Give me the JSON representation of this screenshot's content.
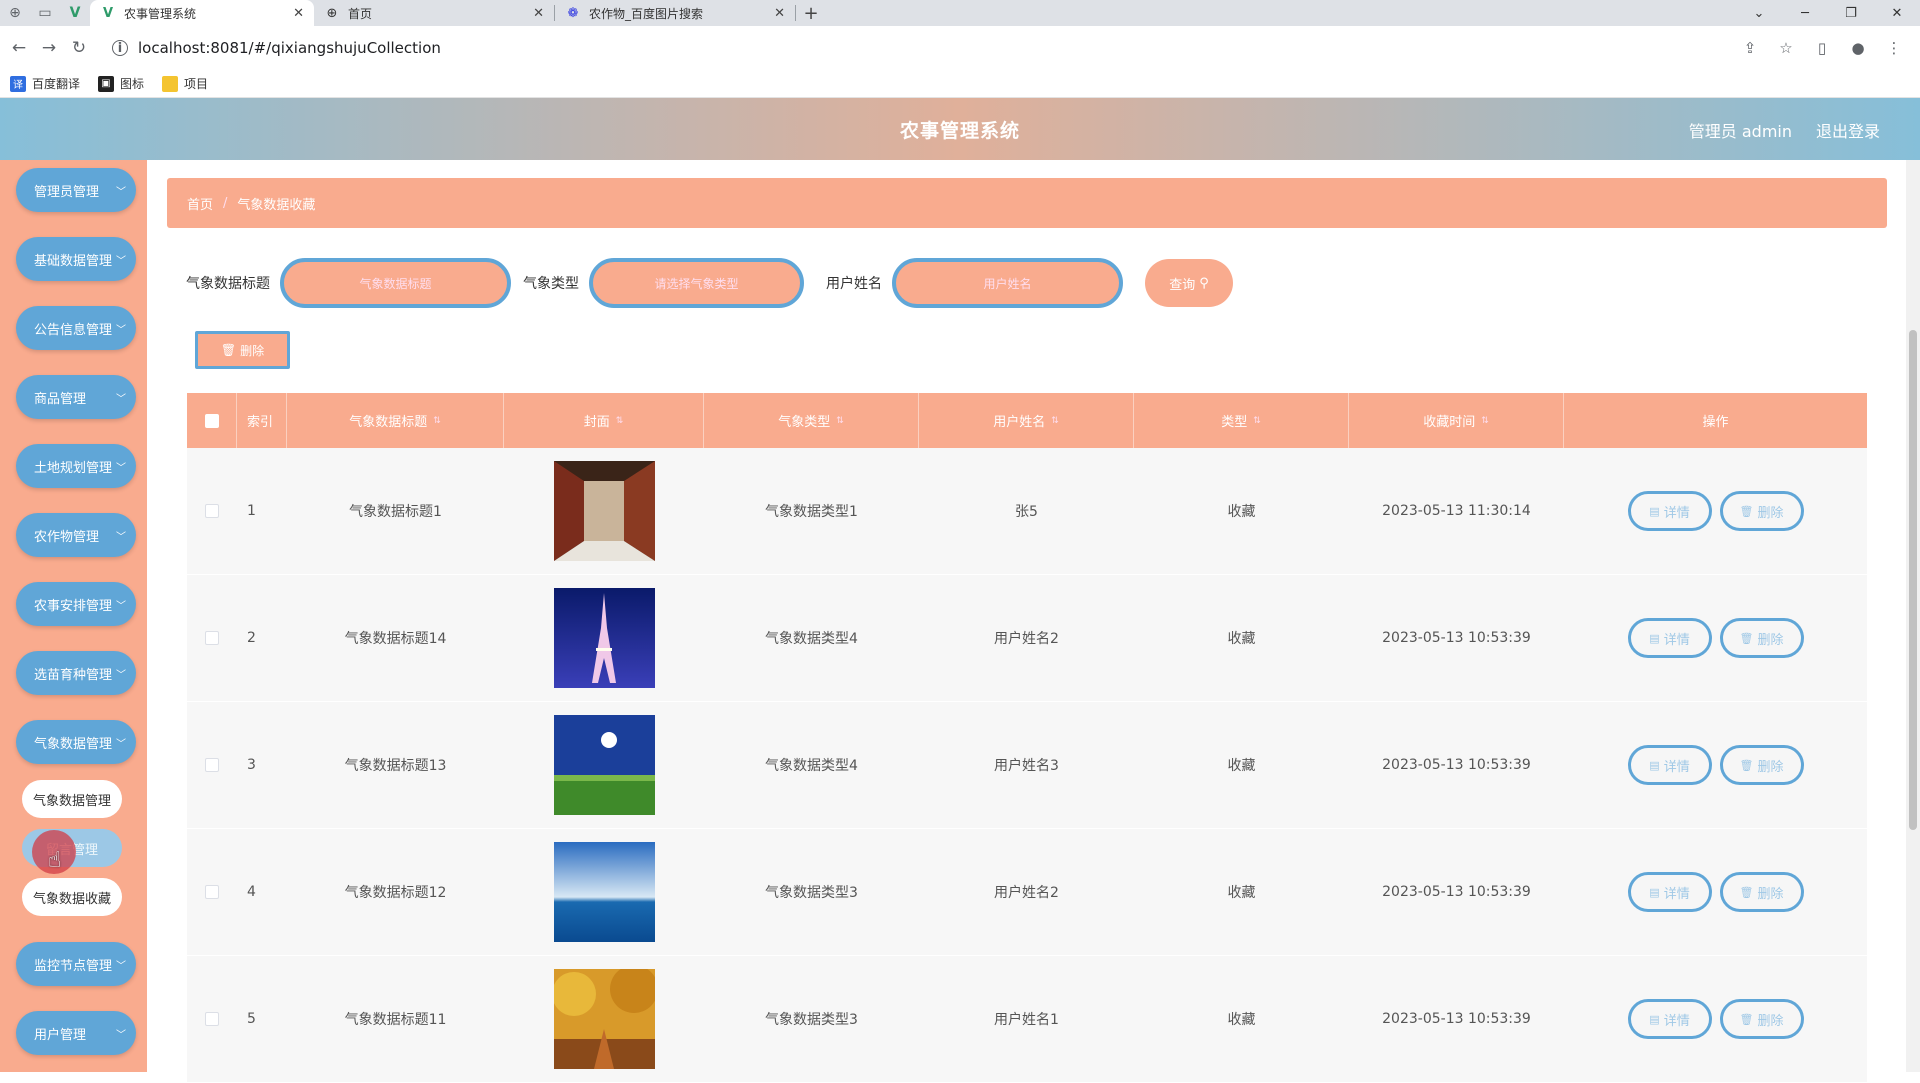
{
  "browser": {
    "tabs": [
      {
        "title": "农事管理系统",
        "close": "✕"
      },
      {
        "title": "首页",
        "close": "✕"
      },
      {
        "title": "农作物_百度图片搜索",
        "close": "✕"
      }
    ],
    "url": "localhost:8081/#/qixiangshujuCollection",
    "bookmarks": [
      "百度翻译",
      "图标",
      "项目"
    ]
  },
  "header": {
    "title": "农事管理系统",
    "user": "管理员 admin",
    "logout": "退出登录"
  },
  "sidebar": {
    "items": [
      {
        "label": "管理员管理",
        "chevron": "﹀"
      },
      {
        "label": "基础数据管理",
        "chevron": "﹀"
      },
      {
        "label": "公告信息管理",
        "chevron": "﹀"
      },
      {
        "label": "商品管理",
        "chevron": "﹀"
      },
      {
        "label": "土地规划管理",
        "chevron": "﹀"
      },
      {
        "label": "农作物管理",
        "chevron": "﹀"
      },
      {
        "label": "农事安排管理",
        "chevron": "﹀"
      },
      {
        "label": "选苗育种管理",
        "chevron": "﹀"
      },
      {
        "label": "气象数据管理",
        "chevron": "﹀"
      },
      {
        "label": "监控节点管理",
        "chevron": "﹀"
      },
      {
        "label": "用户管理",
        "chevron": "﹀"
      }
    ],
    "subitems": [
      {
        "label": "气象数据管理"
      },
      {
        "label": "留言管理"
      },
      {
        "label": "气象数据收藏"
      }
    ]
  },
  "breadcrumb": {
    "home": "首页",
    "sep": "/",
    "current": "气象数据收藏"
  },
  "search": {
    "title_label": "气象数据标题",
    "title_placeholder": "气象数据标题",
    "type_label": "气象类型",
    "type_placeholder": "请选择气象类型",
    "user_label": "用户姓名",
    "user_placeholder": "用户姓名",
    "query_btn": "查询"
  },
  "actions": {
    "delete": "删除"
  },
  "table": {
    "headers": [
      "索引",
      "气象数据标题",
      "封面",
      "气象类型",
      "用户姓名",
      "类型",
      "收藏时间",
      "操作"
    ],
    "detail_btn": "详情",
    "delete_btn": "删除",
    "rows": [
      {
        "index": "1",
        "title": "气象数据标题1",
        "type": "气象数据类型1",
        "user": "张5",
        "kind": "收藏",
        "time": "2023-05-13 11:30:14"
      },
      {
        "index": "2",
        "title": "气象数据标题14",
        "type": "气象数据类型4",
        "user": "用户姓名2",
        "kind": "收藏",
        "time": "2023-05-13 10:53:39"
      },
      {
        "index": "3",
        "title": "气象数据标题13",
        "type": "气象数据类型4",
        "user": "用户姓名3",
        "kind": "收藏",
        "time": "2023-05-13 10:53:39"
      },
      {
        "index": "4",
        "title": "气象数据标题12",
        "type": "气象数据类型3",
        "user": "用户姓名2",
        "kind": "收藏",
        "time": "2023-05-13 10:53:39"
      },
      {
        "index": "5",
        "title": "气象数据标题11",
        "type": "气象数据类型3",
        "user": "用户姓名1",
        "kind": "收藏",
        "time": "2023-05-13 10:53:39"
      }
    ]
  },
  "colors": {
    "accent": "#f9ab8e",
    "secondary": "#60a6d7"
  }
}
